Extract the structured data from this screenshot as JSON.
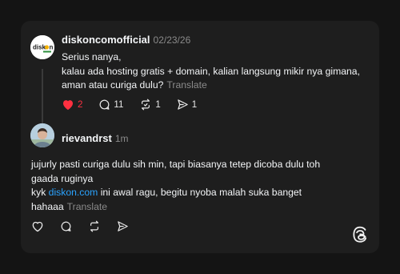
{
  "post": {
    "author": "diskoncomofficial",
    "date": "02/23/26",
    "avatar_text": "disk",
    "avatar_text2": "n",
    "lines": [
      "Serius nanya,",
      "kalau ada hosting gratis + domain, kalian langsung mikir nya gimana,",
      "aman atau curiga dulu?"
    ],
    "translate": "Translate",
    "likes": "2",
    "replies": "11",
    "reposts": "1",
    "shares": "1"
  },
  "reply": {
    "author": "rievandrst",
    "time": "1m",
    "line1": "jujurly pasti curiga dulu sih min, tapi biasanya tetep dicoba dulu toh",
    "line2": "gaada ruginya",
    "line3_prefix": "kyk ",
    "line3_link": "diskon.com",
    "line3_suffix": " ini awal ragu, begitu nyoba malah suka banget",
    "line4": "hahaaa",
    "translate": "Translate"
  },
  "colors": {
    "accent_like": "#ff3040",
    "link": "#2aa3ff",
    "background": "#141414",
    "card": "#1e1e1e"
  },
  "icons": [
    "heart-icon",
    "comment-icon",
    "repost-icon",
    "share-icon",
    "threads-logo-icon"
  ]
}
